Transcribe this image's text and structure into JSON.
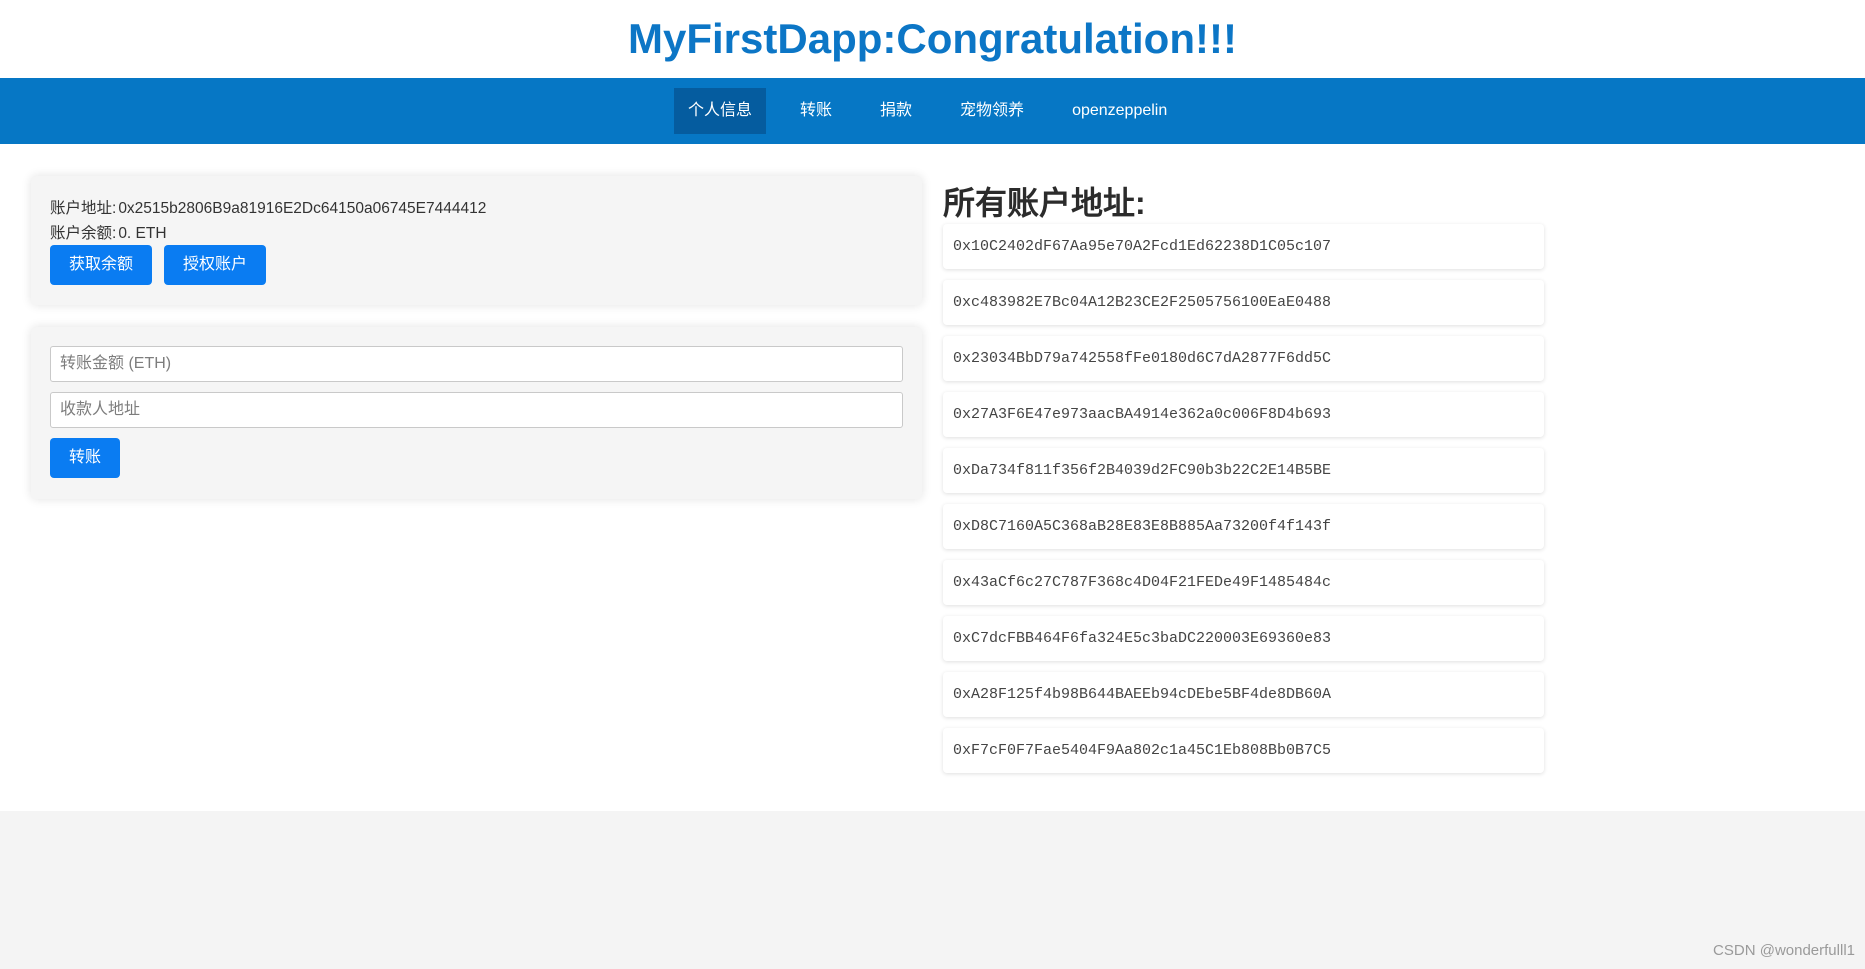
{
  "app_title": "MyFirstDapp:Congratulation!!!",
  "nav": {
    "items": [
      "个人信息",
      "转账",
      "捐款",
      "宠物领养",
      "openzeppelin"
    ],
    "active": "个人信息"
  },
  "account_info": {
    "address_label": "账户地址:",
    "address_value": "0x2515b2806B9a81916E2Dc64150a06745E7444412",
    "balance_label": "账户余额:",
    "balance_value": "0. ETH",
    "get_balance_button": "获取余额",
    "authorize_button": "授权账户"
  },
  "transfer_form": {
    "amount_placeholder": "转账金额 (ETH)",
    "recipient_placeholder": "收款人地址",
    "submit_button": "转账"
  },
  "accounts": {
    "title": "所有账户地址:",
    "list": [
      "0x10C2402dF67Aa95e70A2Fcd1Ed62238D1C05c107",
      "0xc483982E7Bc04A12B23CE2F2505756100EaE0488",
      "0x23034BbD79a742558fFe0180d6C7dA2877F6dd5C",
      "0x27A3F6E47e973aacBA4914e362a0c006F8D4b693",
      "0xDa734f811f356f2B4039d2FC90b3b22C2E14B5BE",
      "0xD8C7160A5C368aB28E83E8B885Aa73200f4f143f",
      "0x43aCf6c27C787F368c4D04F21FEDe49F1485484c",
      "0xC7dcFBB464F6fa324E5c3baDC220003E69360e83",
      "0xA28F125f4b98B644BAEEb94cDEbe5BF4de8DB60A",
      "0xF7cF0F7Fae5404F9Aa802c1a45C1Eb808Bb0B7C5"
    ]
  },
  "watermark": "CSDN @wonderfulll1",
  "colors": {
    "brand_blue": "#0677c5",
    "title_blue": "#0c76c6",
    "button_blue": "#0a7cf2",
    "nav_active": "#055c9f"
  }
}
